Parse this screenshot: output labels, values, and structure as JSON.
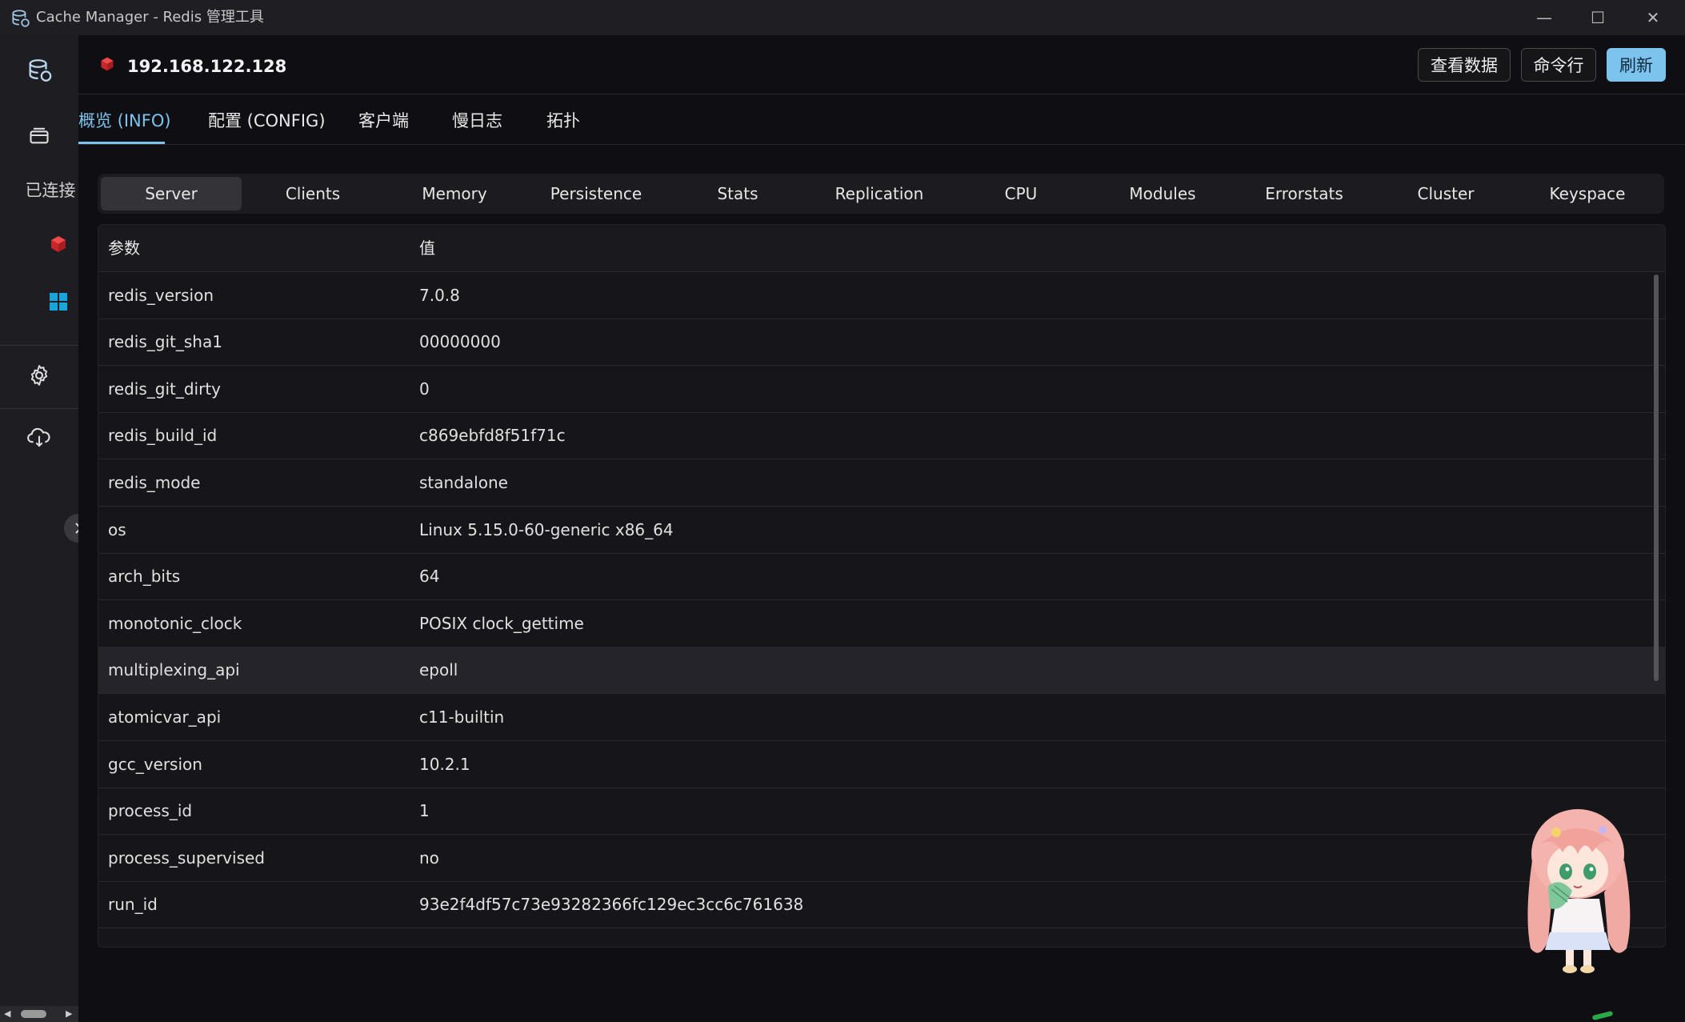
{
  "window": {
    "title": "Cache Manager - Redis 管理工具",
    "controls": {
      "minimize": "—",
      "maximize": "☐",
      "close": "✕"
    }
  },
  "sidebar": {
    "connected_label": "已连接",
    "collapse_glyph": "›"
  },
  "header": {
    "server_name": "192.168.122.128",
    "buttons": {
      "view_data": "查看数据",
      "command_line": "命令行",
      "refresh": "刷新"
    }
  },
  "main_tabs": [
    {
      "label": "概览 (INFO)",
      "active": true
    },
    {
      "label": "配置 (CONFIG)",
      "active": false
    },
    {
      "label": "客户端",
      "active": false
    },
    {
      "label": "慢日志",
      "active": false
    },
    {
      "label": "拓扑",
      "active": false
    }
  ],
  "sections": [
    "Server",
    "Clients",
    "Memory",
    "Persistence",
    "Stats",
    "Replication",
    "CPU",
    "Modules",
    "Errorstats",
    "Cluster",
    "Keyspace"
  ],
  "active_section": "Server",
  "table": {
    "headers": {
      "param": "参数",
      "value": "值"
    },
    "rows": [
      {
        "param": "redis_version",
        "value": "7.0.8"
      },
      {
        "param": "redis_git_sha1",
        "value": "00000000"
      },
      {
        "param": "redis_git_dirty",
        "value": "0"
      },
      {
        "param": "redis_build_id",
        "value": "c869ebfd8f51f71c"
      },
      {
        "param": "redis_mode",
        "value": "standalone"
      },
      {
        "param": "os",
        "value": "Linux 5.15.0-60-generic x86_64"
      },
      {
        "param": "arch_bits",
        "value": "64"
      },
      {
        "param": "monotonic_clock",
        "value": "POSIX clock_gettime"
      },
      {
        "param": "multiplexing_api",
        "value": "epoll"
      },
      {
        "param": "atomicvar_api",
        "value": "c11-builtin"
      },
      {
        "param": "gcc_version",
        "value": "10.2.1"
      },
      {
        "param": "process_id",
        "value": "1"
      },
      {
        "param": "process_supervised",
        "value": "no"
      },
      {
        "param": "run_id",
        "value": "93e2f4df57c73e93282366fc129ec3cc6c761638"
      }
    ],
    "hovered_row": 8
  },
  "colors": {
    "accent": "#7cc3ee",
    "redis_red": "#d9302c",
    "windows_blue": "#1aa4dc"
  },
  "icons": {
    "app": "database-icon",
    "sidebar": [
      "database-icon",
      "layers-icon",
      "redis-cube-icon",
      "windows-grid-icon",
      "gear-icon",
      "cloud-download-icon"
    ]
  }
}
